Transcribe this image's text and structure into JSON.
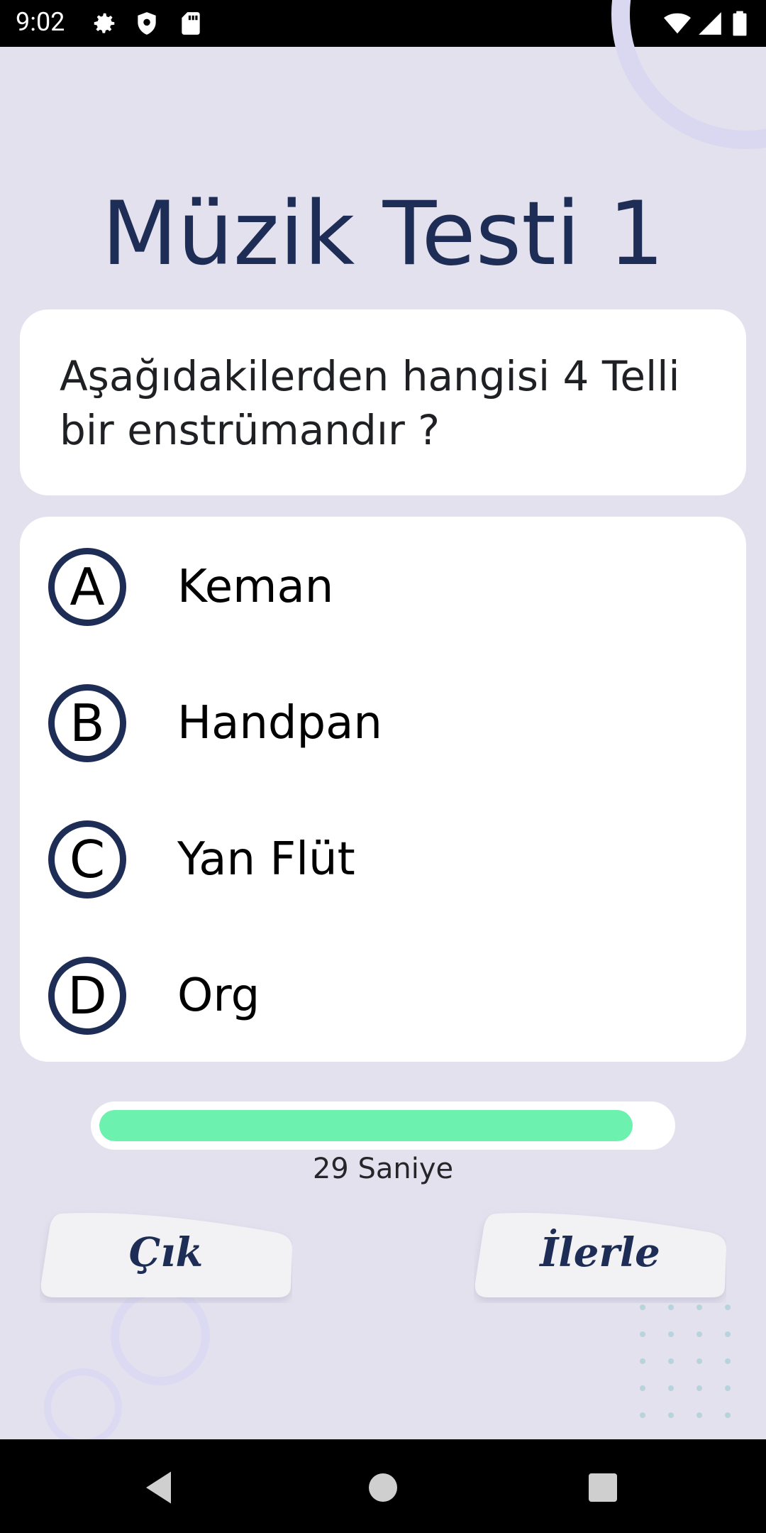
{
  "status_bar": {
    "time": "9:02",
    "icons_left": [
      "gear-icon",
      "shield-icon",
      "sd-card-icon"
    ],
    "icons_right": [
      "wifi-icon",
      "cellular-signal-icon",
      "battery-icon"
    ]
  },
  "quiz": {
    "title": "Müzik Testi 1",
    "question": "Aşağıdakilerden hangisi 4 Telli bir enstrümandır ?",
    "options": [
      {
        "letter": "A",
        "text": "Keman"
      },
      {
        "letter": "B",
        "text": "Handpan"
      },
      {
        "letter": "C",
        "text": "Yan Flüt"
      },
      {
        "letter": "D",
        "text": "Org"
      }
    ]
  },
  "timer": {
    "label": "29 Saniye",
    "progress": 0.94
  },
  "buttons": {
    "exit_label": "Çık",
    "next_label": "İlerle"
  },
  "navigation": {
    "icons": [
      "back-icon",
      "home-icon",
      "recents-icon"
    ]
  },
  "colors": {
    "background": "#e3e1ee",
    "title": "#1e2d55",
    "accent_progress": "#6cf2ae"
  }
}
